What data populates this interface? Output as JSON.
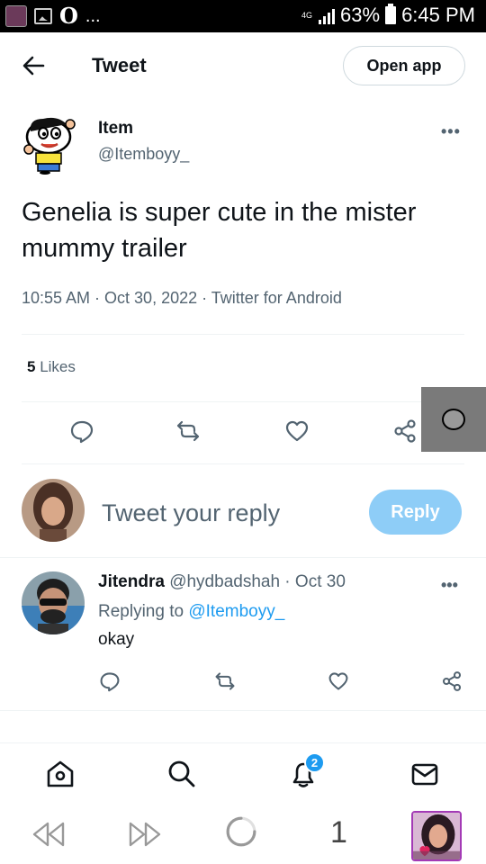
{
  "status_bar": {
    "notification_letter": "O",
    "more_indicator": "...",
    "network": "4G",
    "battery": "63%",
    "time": "6:45 PM"
  },
  "header": {
    "title": "Tweet",
    "open_app_label": "Open app"
  },
  "tweet": {
    "author_name": "Item",
    "author_handle": "@Itemboyy_",
    "more_label": "•••",
    "text": "Genelia is super cute in the mister mummy trailer",
    "meta": "10:55 AM · Oct 30, 2022 · Twitter for Android",
    "likes_count": "5",
    "likes_label": " Likes"
  },
  "reply_composer": {
    "placeholder": "Tweet your reply",
    "button_label": "Reply",
    "button_color": "#8ecdf7"
  },
  "replies": [
    {
      "name": "Jitendra",
      "handle": "@hydbadshah",
      "date": " · Oct 30",
      "replying_prefix": "Replying to ",
      "replying_to": "@Itemboyy_",
      "text": "okay",
      "more_label": "•••"
    }
  ],
  "bottom_nav": {
    "items": [
      "home-icon",
      "search-icon",
      "notifications-icon",
      "messages-icon"
    ],
    "notification_badge": "2"
  },
  "browser_bar": {
    "tab_count": "1"
  },
  "colors": {
    "accent": "#1d9bf0",
    "secondary_text": "#536471",
    "primary_text": "#0f1419"
  }
}
